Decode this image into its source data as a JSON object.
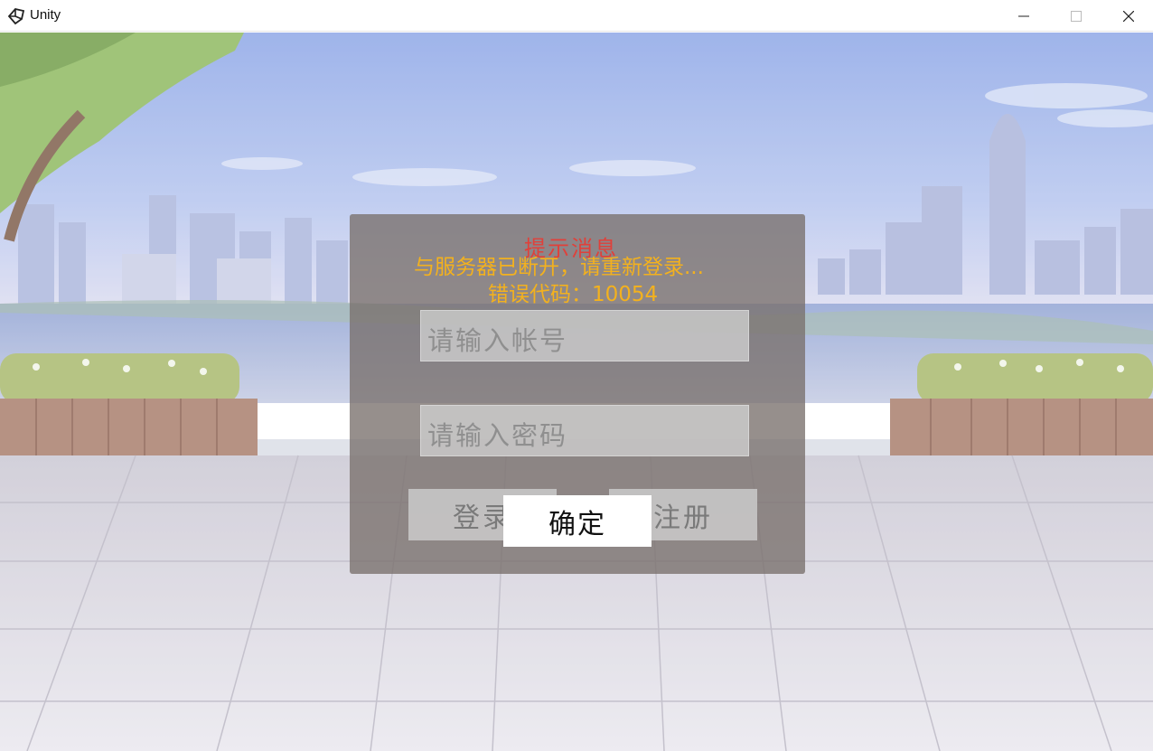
{
  "window": {
    "title": "Unity",
    "icon": "unity-logo-icon",
    "controls": [
      "minimize-icon",
      "maximize-icon",
      "close-icon"
    ]
  },
  "login": {
    "username_placeholder": "请输入帐号",
    "password_placeholder": "请输入密码",
    "login_label": "登录",
    "register_label": "注册"
  },
  "alert": {
    "title": "提示消息",
    "message": "与服务器已断开，请重新登录...",
    "error_code": "错误代码：10054",
    "confirm_label": "确定"
  },
  "colors": {
    "alert_title": "#e0403a",
    "alert_text": "#f3b11e",
    "panel": "#78706c"
  }
}
